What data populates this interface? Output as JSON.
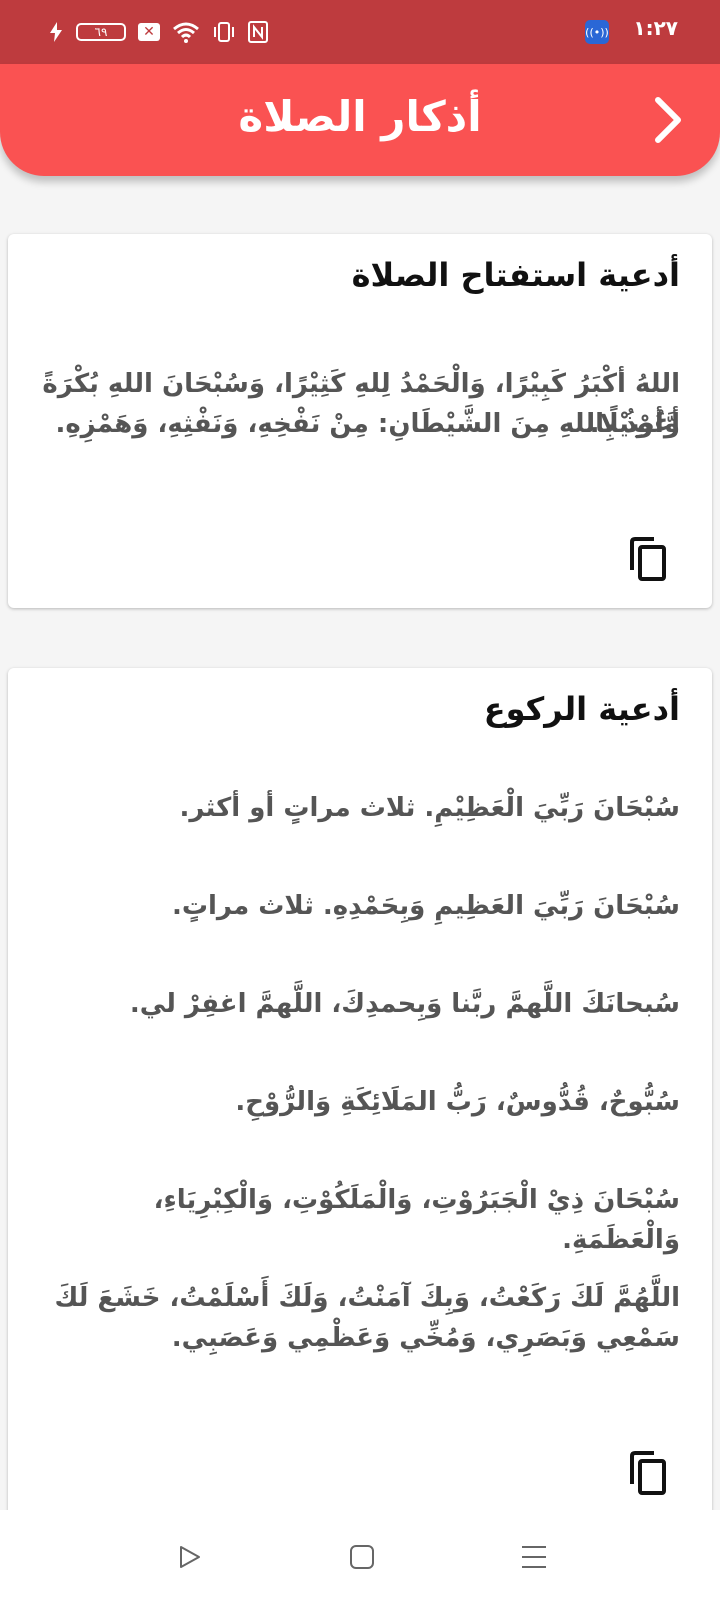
{
  "status": {
    "time": "١:٢٧",
    "battery": "٦٩"
  },
  "header": {
    "title": "أذكار الصلاة"
  },
  "cards": [
    {
      "title": "أدعية استفتاح الصلاة",
      "lines": [
        "اللهُ أكْبَرُ كَبِيْرًا، وَالْحَمْدُ لِلهِ كَثِيْرًا، وَسُبْحَانَ اللهِ بُكْرَةً وَّأصِيْلًا.",
        "أعُوْذُ بِاللهِ مِنَ الشَّيْطَانِ: مِنْ نَفْخِهِ، وَنَفْثِهِ، وَهَمْزِهِ."
      ]
    },
    {
      "title": "أدعية الركوع",
      "lines": [
        "سُبْحَانَ رَبِّيَ الْعَظِيْمِ. ثلاث مراتٍ أو أكثر.",
        "سُبْحَانَ رَبِّيَ العَظِيمِ وَبِحَمْدِهِ. ثلاث مراتٍ.",
        "سُبحانَكَ اللَّهمَّ ربَّنا وَبِحمدِكَ، اللَّهمَّ اغفِرْ لي.",
        "سُبُّوحٌ، قُدُّوسٌ، رَبُّ المَلَائِكَةِ وَالرُّوْحِ.",
        "سُبْحَانَ ذِيْ الْجَبَرُوْتِ، وَالْمَلَكُوْتِ، وَالْكِبْرِيَاءِ، وَالْعَظَمَةِ.",
        "اللَّهُمَّ لَكَ رَكَعْتُ، وَبِكَ آمَنْتُ، وَلَكَ أَسْلَمْتُ، خَشَعَ لَكَ",
        "سَمْعِي وَبَصَرِي، وَمُخِّي وَعَظْمِي وَعَصَبِي."
      ]
    }
  ]
}
